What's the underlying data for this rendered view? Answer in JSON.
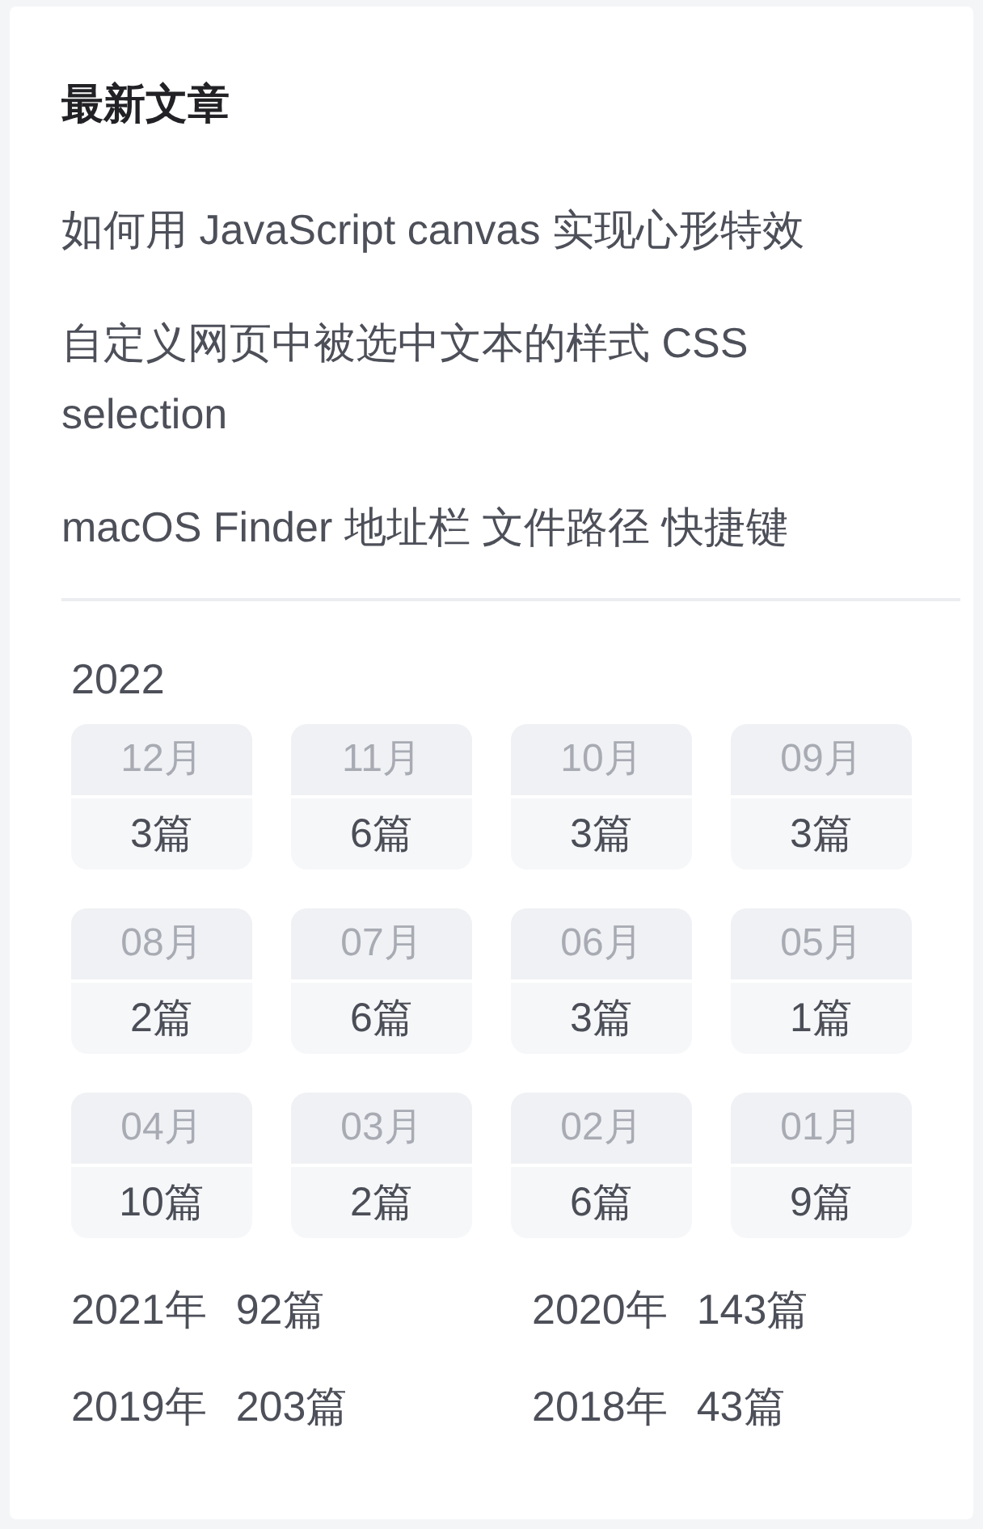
{
  "title": "最新文章",
  "articles": [
    "如何用 JavaScript canvas 实现心形特效",
    "自定义网页中被选中文本的样式 CSS selection",
    "macOS Finder 地址栏 文件路径 快捷键"
  ],
  "archive": {
    "year": "2022",
    "months": [
      {
        "month": "12月",
        "count": "3篇"
      },
      {
        "month": "11月",
        "count": "6篇"
      },
      {
        "month": "10月",
        "count": "3篇"
      },
      {
        "month": "09月",
        "count": "3篇"
      },
      {
        "month": "08月",
        "count": "2篇"
      },
      {
        "month": "07月",
        "count": "6篇"
      },
      {
        "month": "06月",
        "count": "3篇"
      },
      {
        "month": "05月",
        "count": "1篇"
      },
      {
        "month": "04月",
        "count": "10篇"
      },
      {
        "month": "03月",
        "count": "2篇"
      },
      {
        "month": "02月",
        "count": "6篇"
      },
      {
        "month": "01月",
        "count": "9篇"
      }
    ],
    "years": [
      {
        "year": "2021年",
        "count": "92篇"
      },
      {
        "year": "2020年",
        "count": "143篇"
      },
      {
        "year": "2019年",
        "count": "203篇"
      },
      {
        "year": "2018年",
        "count": "43篇"
      }
    ]
  }
}
